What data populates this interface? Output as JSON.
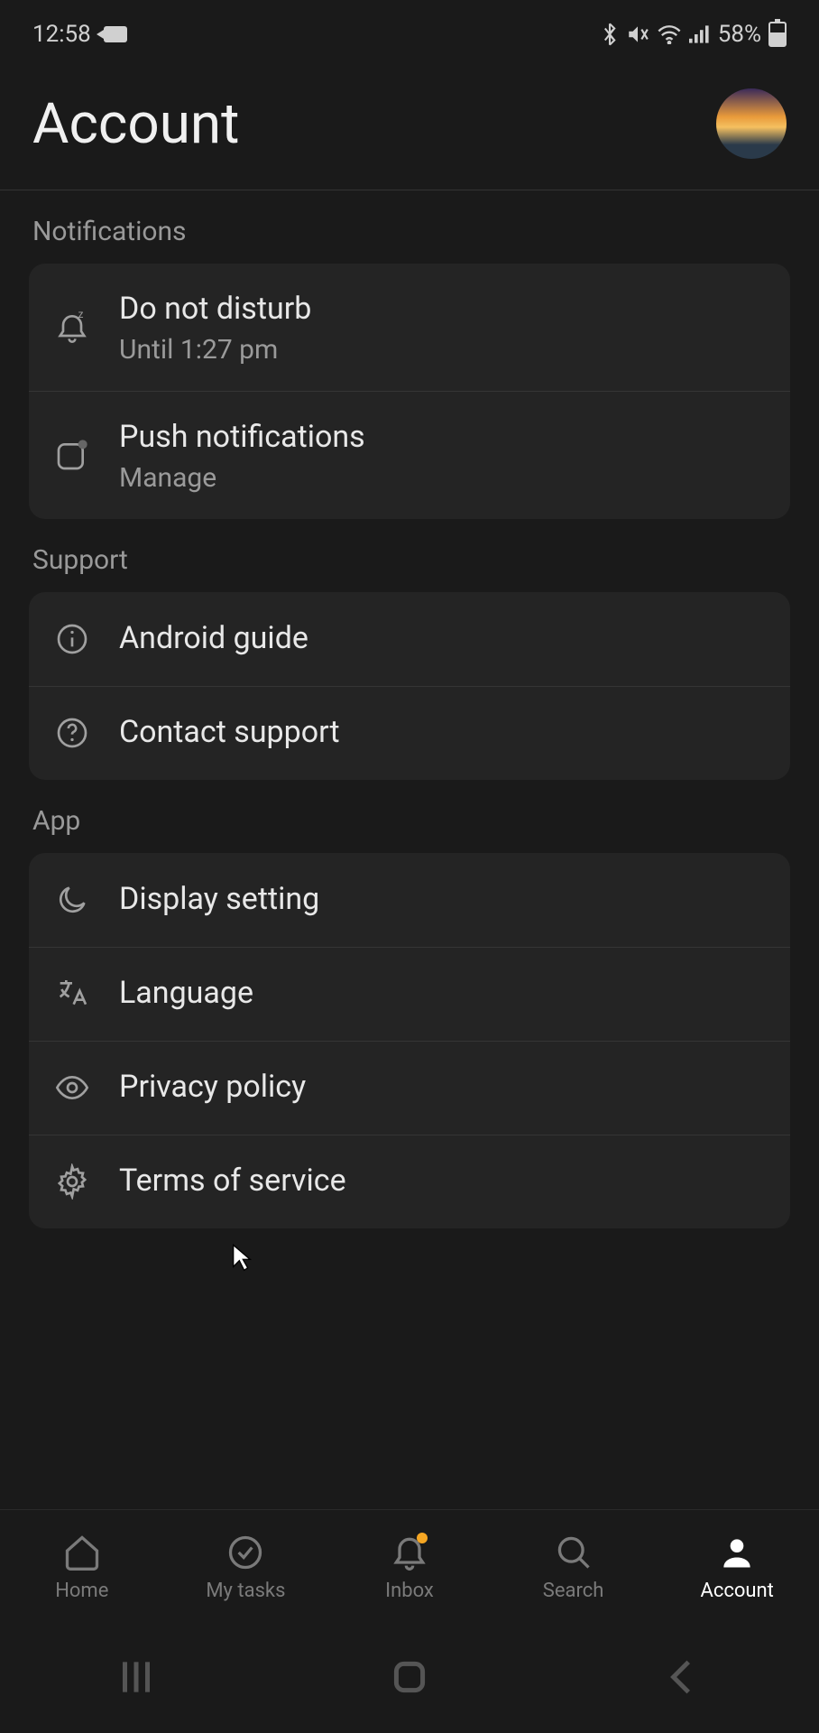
{
  "status": {
    "time": "12:58",
    "battery_pct": "58%"
  },
  "header": {
    "title": "Account"
  },
  "sections": {
    "notifications": {
      "label": "Notifications",
      "items": [
        {
          "title": "Do not disturb",
          "sub": "Until 1:27 pm"
        },
        {
          "title": "Push notifications",
          "sub": "Manage"
        }
      ]
    },
    "support": {
      "label": "Support",
      "items": [
        {
          "title": "Android guide"
        },
        {
          "title": "Contact support"
        }
      ]
    },
    "app": {
      "label": "App",
      "items": [
        {
          "title": "Display setting"
        },
        {
          "title": "Language"
        },
        {
          "title": "Privacy policy"
        },
        {
          "title": "Terms of service"
        }
      ]
    }
  },
  "nav": {
    "home": "Home",
    "mytasks": "My tasks",
    "inbox": "Inbox",
    "search": "Search",
    "account": "Account"
  }
}
